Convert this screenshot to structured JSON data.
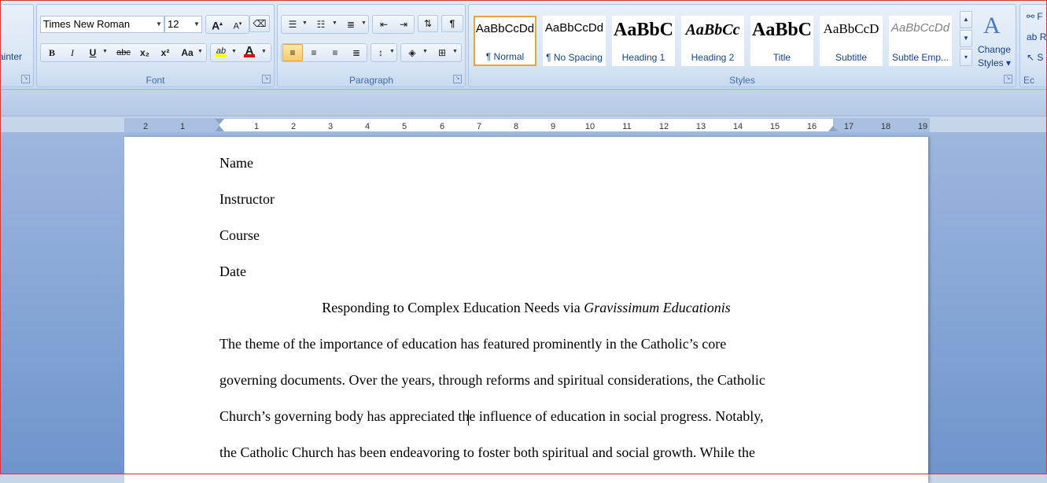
{
  "ribbon": {
    "clipboard": {
      "format_painter_label": "ainter"
    },
    "font": {
      "group_label": "Font",
      "font_name": "Times New Roman",
      "font_size": "12",
      "bold": "B",
      "italic": "I",
      "underline": "U",
      "strikethrough": "abc",
      "subscript": "x₂",
      "superscript": "x²",
      "change_case": "Aa",
      "grow": "A",
      "shrink": "A",
      "highlight_text": "ab",
      "font_color_text": "A",
      "highlight_color": "#ffff00",
      "font_color": "#e60000"
    },
    "paragraph": {
      "group_label": "Paragraph",
      "pilcrow": "¶"
    },
    "styles": {
      "group_label": "Styles",
      "items": [
        {
          "preview": "AaBbCcDd",
          "name": "¶ Normal",
          "selected": true
        },
        {
          "preview": "AaBbCcDd",
          "name": "¶ No Spacing",
          "selected": false
        },
        {
          "preview": "AaBbC",
          "name": "Heading 1",
          "selected": false
        },
        {
          "preview": "AaBbCc",
          "name": "Heading 2",
          "selected": false
        },
        {
          "preview": "AaBbC",
          "name": "Title",
          "selected": false
        },
        {
          "preview": "AaBbCcD",
          "name": "Subtitle",
          "selected": false
        },
        {
          "preview": "AaBbCcDd",
          "name": "Subtle Emp...",
          "selected": false
        }
      ],
      "change_styles_line1": "Change",
      "change_styles_line2": "Styles ▾"
    },
    "editing": {
      "group_label": "Ec",
      "find_label": "F",
      "replace_label": "R",
      "select_label": "S"
    }
  },
  "ruler": {
    "numbers_left": [
      "2",
      "1"
    ],
    "numbers_right": [
      "1",
      "2",
      "3",
      "4",
      "5",
      "6",
      "7",
      "8",
      "9",
      "10",
      "11",
      "12",
      "13",
      "14",
      "15",
      "16",
      "17",
      "18",
      "19"
    ]
  },
  "document": {
    "lines": [
      "Name",
      "Instructor",
      "Course",
      "Date"
    ],
    "title_plain": "Responding to Complex Education Needs via ",
    "title_italic": "Gravissimum Educationis",
    "body_lines": [
      "The theme of the importance of education has featured prominently in the Catholic’s core",
      "governing documents. Over the years, through reforms and spiritual considerations, the Catholic",
      "Church’s governing body has appreciated the influence of education in social progress. Notably,",
      "the Catholic Church has been endeavoring to foster both spiritual and social growth. While the"
    ]
  }
}
